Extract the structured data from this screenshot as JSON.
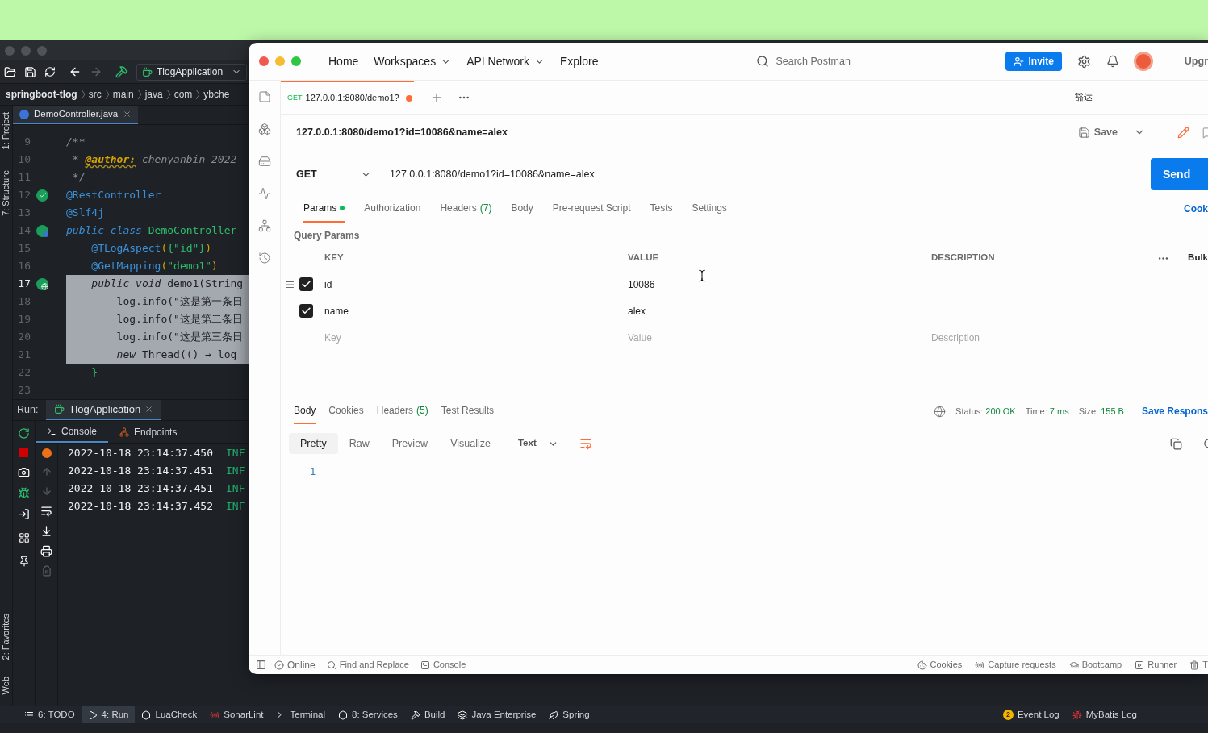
{
  "ide": {
    "run_config": "TlogApplication",
    "breadcrumbs": [
      "springboot-tlog",
      "src",
      "main",
      "java",
      "com",
      "ybche"
    ],
    "side_tabs_top": [
      "1: Project",
      "7: Structure"
    ],
    "side_tabs_bottom": [
      "2: Favorites",
      "Web"
    ],
    "editor_tab": "DemoController.java",
    "code_lines": [
      {
        "number": "9",
        "selected": false,
        "kind": "plain",
        "tokens": [
          {
            "text": "/**",
            "kind": "comment"
          }
        ]
      },
      {
        "number": "10",
        "selected": false,
        "kind": "plain",
        "tokens": [
          {
            "text": " * ",
            "kind": "comment"
          },
          {
            "text": "@author:",
            "kind": "doctag"
          },
          {
            "text": " chenyanbin 2022-",
            "kind": "comment"
          }
        ]
      },
      {
        "number": "11",
        "selected": false,
        "kind": "plain",
        "tokens": [
          {
            "text": " */",
            "kind": "comment"
          }
        ]
      },
      {
        "number": "12",
        "selected": false,
        "kind": "check",
        "tokens": [
          {
            "text": "@RestController",
            "kind": "annotation"
          }
        ]
      },
      {
        "number": "13",
        "selected": false,
        "kind": "plain",
        "tokens": [
          {
            "text": "@Slf4j",
            "kind": "annotation"
          }
        ]
      },
      {
        "number": "14",
        "selected": false,
        "kind": "class",
        "tokens": [
          {
            "text": "public class ",
            "kind": "keyword"
          },
          {
            "text": "DemoController",
            "kind": "classname"
          }
        ]
      },
      {
        "number": "15",
        "selected": false,
        "kind": "plain",
        "tokens": [
          {
            "text": "    @TLogAspect",
            "kind": "annotation"
          },
          {
            "text": "(",
            "kind": "paren"
          },
          {
            "text": "{",
            "kind": "brace"
          },
          {
            "text": "\"id\"",
            "kind": "string"
          },
          {
            "text": "}",
            "kind": "brace"
          },
          {
            "text": ")",
            "kind": "paren"
          }
        ]
      },
      {
        "number": "16",
        "selected": false,
        "kind": "plain",
        "tokens": [
          {
            "text": "    @GetMapping",
            "kind": "annotation"
          },
          {
            "text": "(",
            "kind": "paren"
          },
          {
            "text": "\"demo1\"",
            "kind": "string"
          },
          {
            "text": ")",
            "kind": "paren"
          }
        ]
      },
      {
        "number": "17",
        "selected": true,
        "kind": "endpoint",
        "tokens": [
          {
            "text": "    public void",
            "kind": "keyword"
          },
          {
            "text": " demo1(String",
            "kind": "plain"
          }
        ]
      },
      {
        "number": "18",
        "selected": true,
        "kind": "plain",
        "tokens": [
          {
            "text": "        log.info(\"这是第一条日",
            "kind": "plain"
          }
        ]
      },
      {
        "number": "19",
        "selected": true,
        "kind": "plain",
        "tokens": [
          {
            "text": "        log.info(\"这是第二条日",
            "kind": "plain"
          }
        ]
      },
      {
        "number": "20",
        "selected": true,
        "kind": "plain",
        "tokens": [
          {
            "text": "        log.info(\"这是第三条日",
            "kind": "plain"
          }
        ]
      },
      {
        "number": "21",
        "selected": true,
        "kind": "plain",
        "tokens": [
          {
            "text": "        new",
            "kind": "keyword"
          },
          {
            "text": " Thread(() → log",
            "kind": "plain"
          }
        ]
      },
      {
        "number": "22",
        "selected": false,
        "kind": "plain",
        "tokens": [
          {
            "text": "    }",
            "kind": "brace"
          }
        ]
      },
      {
        "number": "23",
        "selected": false,
        "kind": "plain"
      }
    ],
    "run": {
      "label": "Run:",
      "tab": "TlogApplication",
      "subtabs": [
        {
          "label": "Console",
          "selected": true
        },
        {
          "label": "Endpoints",
          "selected": false
        }
      ],
      "log_lines": [
        {
          "time": "2022-10-18 23:14:37.450",
          "level": "INF"
        },
        {
          "time": "2022-10-18 23:14:37.451",
          "level": "INF"
        },
        {
          "time": "2022-10-18 23:14:37.451",
          "level": "INF"
        },
        {
          "time": "2022-10-18 23:14:37.452",
          "level": "INF"
        }
      ]
    },
    "tool_windows": [
      {
        "label": "6: TODO",
        "selected": false
      },
      {
        "label": "4: Run",
        "selected": true
      },
      {
        "label": "LuaCheck",
        "selected": false
      },
      {
        "label": "SonarLint",
        "selected": false
      },
      {
        "label": "Terminal",
        "selected": false
      },
      {
        "label": "8: Services",
        "selected": false
      },
      {
        "label": "Build",
        "selected": false
      },
      {
        "label": "Java Enterprise",
        "selected": false
      },
      {
        "label": "Spring",
        "selected": false
      }
    ],
    "right_tools": [
      {
        "label": "Event Log",
        "badge": "2"
      },
      {
        "label": "MyBatis Log"
      }
    ]
  },
  "postman": {
    "nav": [
      {
        "label": "Home",
        "dropdown": false
      },
      {
        "label": "Workspaces",
        "dropdown": true
      },
      {
        "label": "API Network",
        "dropdown": true
      },
      {
        "label": "Explore",
        "dropdown": false
      }
    ],
    "search": {
      "placeholder": "Search Postman"
    },
    "invite": "Invite",
    "upgrade": "Upgr",
    "request_tab": {
      "method": "GET",
      "title": "127.0.0.1:8080/demo1?",
      "unsaved": true
    },
    "environment": "豁达",
    "request_name": "127.0.0.1:8080/demo1?id=10086&name=alex",
    "save": "Save",
    "method": "GET",
    "url": "127.0.0.1:8080/demo1?id=10086&name=alex",
    "send": "Send",
    "request_tabs": [
      {
        "label": "Params",
        "indicator": true,
        "selected": true
      },
      {
        "label": "Authorization",
        "indicator": false,
        "selected": false
      },
      {
        "label": "Headers",
        "count": "(7)",
        "indicator": false,
        "selected": false
      },
      {
        "label": "Body",
        "indicator": false,
        "selected": false
      },
      {
        "label": "Pre-request Script",
        "indicator": false,
        "selected": false
      },
      {
        "label": "Tests",
        "indicator": false,
        "selected": false
      },
      {
        "label": "Settings",
        "indicator": false,
        "selected": false
      }
    ],
    "cookies_link": "Cook",
    "query_params": {
      "title": "Query Params",
      "columns": [
        "KEY",
        "VALUE",
        "DESCRIPTION"
      ],
      "bulk": "Bulk",
      "rows": [
        {
          "key": "id",
          "value": "10086",
          "checked": true
        },
        {
          "key": "name",
          "value": "alex",
          "checked": true
        }
      ],
      "new_row": [
        {
          "placeholder": "Key"
        },
        {
          "placeholder": "Value"
        },
        {
          "placeholder": "Description"
        }
      ]
    },
    "response_tabs": [
      {
        "label": "Body",
        "selected": true
      },
      {
        "label": "Cookies",
        "selected": false
      },
      {
        "label": "Headers",
        "count": "(5)",
        "selected": false
      },
      {
        "label": "Test Results",
        "selected": false
      }
    ],
    "response_stats": [
      {
        "label": "Status:",
        "value": "200 OK"
      },
      {
        "label": "Time:",
        "value": "7 ms"
      },
      {
        "label": "Size:",
        "value": "155 B"
      }
    ],
    "save_response": "Save Respons",
    "view_tabs": [
      {
        "label": "Pretty",
        "selected": true
      },
      {
        "label": "Raw",
        "selected": false
      },
      {
        "label": "Preview",
        "selected": false
      },
      {
        "label": "Visualize",
        "selected": false
      }
    ],
    "format": "Text",
    "line_numbers": [
      "1"
    ],
    "footer_left": [
      "Online",
      "Find and Replace",
      "Console"
    ],
    "footer_right": [
      "Cookies",
      "Capture requests",
      "Bootcamp",
      "Runner",
      "T"
    ]
  }
}
